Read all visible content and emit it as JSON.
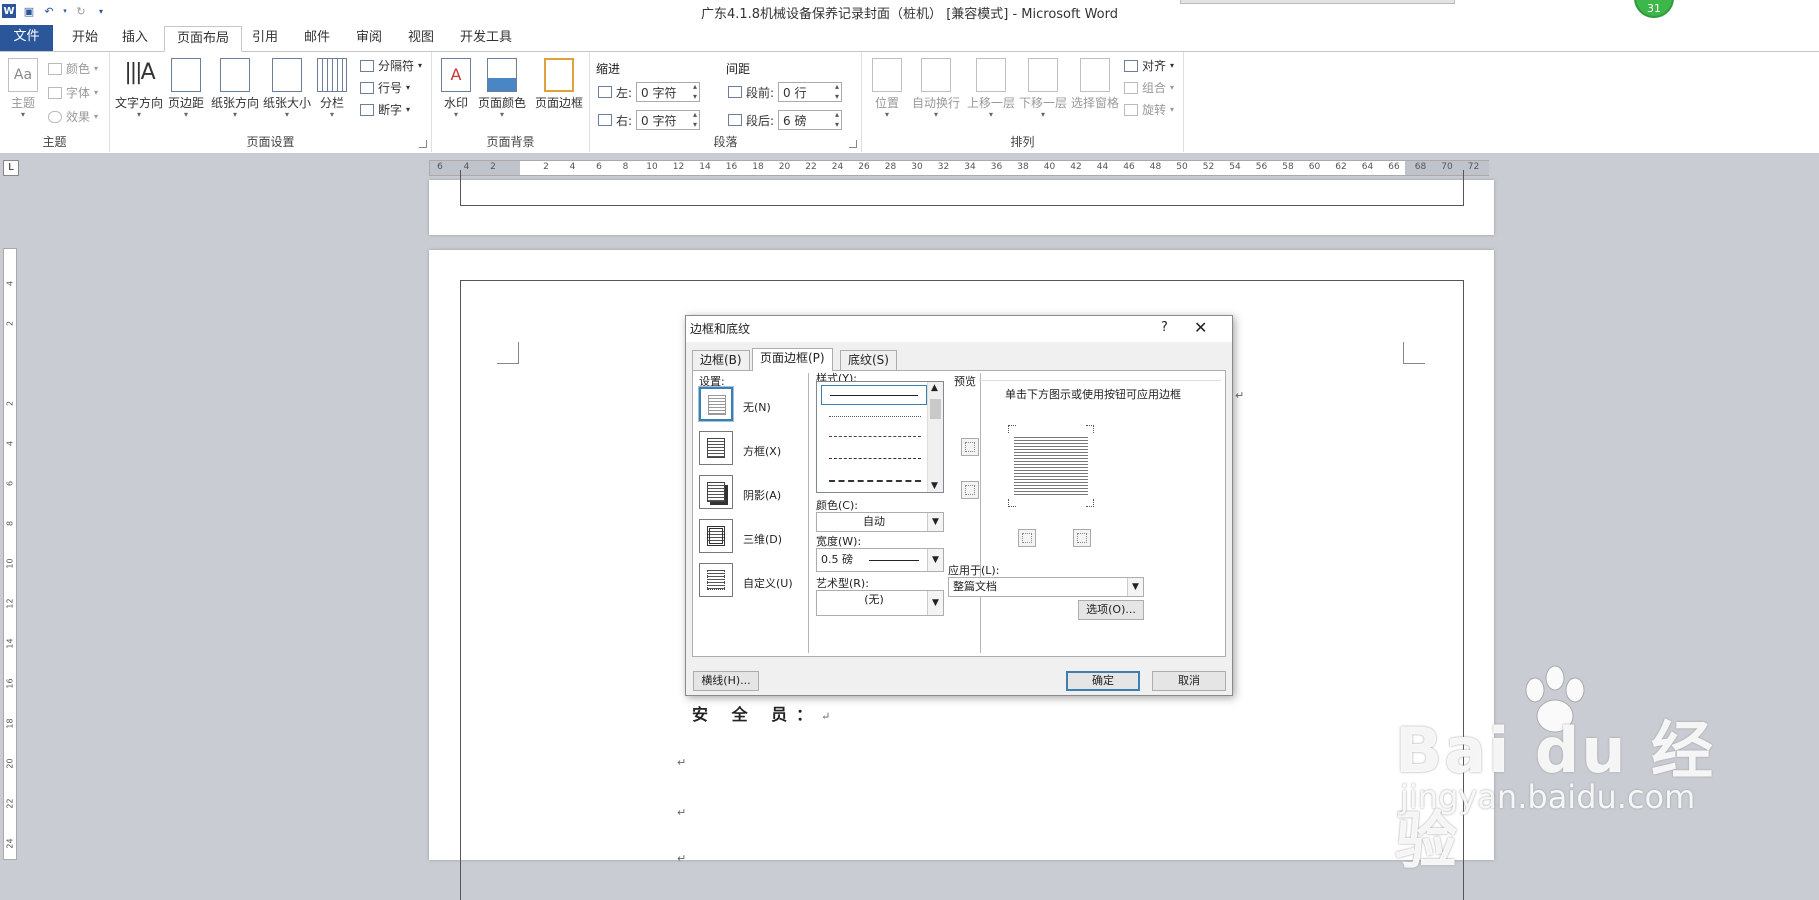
{
  "window": {
    "title": "广东4.1.8机械设备保养记录封面（桩机） [兼容模式] - Microsoft Word",
    "badge": "31"
  },
  "ribbon_tabs": [
    "文件",
    "开始",
    "插入",
    "页面布局",
    "引用",
    "邮件",
    "审阅",
    "视图",
    "开发工具"
  ],
  "active_tab": "页面布局",
  "groups": {
    "theme": {
      "label": "主题",
      "theme_btn": "主题",
      "colors": "颜色",
      "fonts": "字体",
      "effects": "效果"
    },
    "page_setup": {
      "label": "页面设置",
      "text_direction": "文字方向",
      "margins": "页边距",
      "orientation": "纸张方向",
      "size": "纸张大小",
      "columns": "分栏",
      "breaks": "分隔符",
      "line_numbers": "行号",
      "hyphenation": "断字"
    },
    "page_background": {
      "label": "页面背景",
      "watermark": "水印",
      "page_color": "页面颜色",
      "page_borders": "页面边框"
    },
    "paragraph": {
      "label": "段落",
      "indent_title": "缩进",
      "spacing_title": "间距",
      "left_label": "左:",
      "left_value": "0 字符",
      "right_label": "右:",
      "right_value": "0 字符",
      "before_label": "段前:",
      "before_value": "0 行",
      "after_label": "段后:",
      "after_value": "6 磅"
    },
    "arrange": {
      "label": "排列",
      "position": "位置",
      "wrap": "自动换行",
      "bring_forward": "上移一层",
      "send_backward": "下移一层",
      "selection_pane": "选择窗格",
      "align": "对齐",
      "group": "组合",
      "rotate": "旋转"
    }
  },
  "ruler": {
    "numbers": [
      "6",
      "4",
      "2",
      "",
      "2",
      "4",
      "6",
      "8",
      "10",
      "12",
      "14",
      "16",
      "18",
      "20",
      "22",
      "24",
      "26",
      "28",
      "30",
      "32",
      "34",
      "36",
      "38",
      "40",
      "42",
      "44",
      "46",
      "48",
      "50",
      "52",
      "54",
      "56",
      "58",
      "60",
      "62",
      "64",
      "66",
      "68",
      "70",
      "72"
    ],
    "vnumbers": [
      "4",
      "2",
      "",
      "2",
      "4",
      "6",
      "8",
      "10",
      "12",
      "14",
      "16",
      "18",
      "20",
      "22",
      "24"
    ]
  },
  "document": {
    "safety_officer": "安 全 员：",
    "pilcrow": "↵"
  },
  "dialog": {
    "title": "边框和底纹",
    "help": "?",
    "close": "✕",
    "tabs": [
      "边框(B)",
      "页面边框(P)",
      "底纹(S)"
    ],
    "active_tab": "页面边框(P)",
    "settings_label": "设置:",
    "settings": [
      "无(N)",
      "方框(X)",
      "阴影(A)",
      "三维(D)",
      "自定义(U)"
    ],
    "selected_setting": "无(N)",
    "style_label": "样式(Y):",
    "color_label": "颜色(C):",
    "color_value": "自动",
    "width_label": "宽度(W):",
    "width_value": "0.5 磅",
    "art_label": "艺术型(R):",
    "art_value": "(无)",
    "preview_label": "预览",
    "preview_hint": "单击下方图示或使用按钮可应用边框",
    "apply_label": "应用于(L):",
    "apply_value": "整篇文档",
    "options_btn": "选项(O)...",
    "horizontal_line_btn": "横线(H)...",
    "ok_btn": "确定",
    "cancel_btn": "取消"
  },
  "watermark": {
    "brand": "Bai du 经验",
    "url": "jingyan.baidu.com"
  }
}
